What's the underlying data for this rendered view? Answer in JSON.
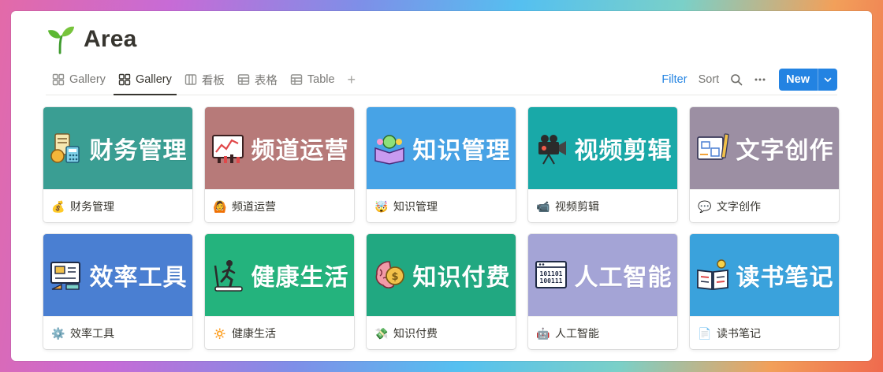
{
  "page": {
    "title": "Area",
    "icon": "seedling-icon"
  },
  "tabs": [
    {
      "label": "Gallery",
      "icon": "gallery-icon",
      "active": false
    },
    {
      "label": "Gallery",
      "icon": "gallery-icon",
      "active": true
    },
    {
      "label": "看板",
      "icon": "board-icon",
      "active": false
    },
    {
      "label": "表格",
      "icon": "table-icon",
      "active": false
    },
    {
      "label": "Table",
      "icon": "table-icon",
      "active": false
    }
  ],
  "add_view": "+",
  "actions": {
    "filter": "Filter",
    "sort": "Sort",
    "new": "New"
  },
  "accent": "#2383e2",
  "cards": [
    {
      "cover_text": "财务管理",
      "title": "财务管理",
      "emoji": "💰",
      "cover_color": "#3a9e93",
      "cover_icon": "money-calculator-icon"
    },
    {
      "cover_text": "频道运营",
      "title": "频道运营",
      "emoji": "🙆",
      "cover_color": "#b77a79",
      "cover_icon": "chart-board-icon"
    },
    {
      "cover_text": "知识管理",
      "title": "知识管理",
      "emoji": "🤯",
      "cover_color": "#47a3e6",
      "cover_icon": "book-idea-icon"
    },
    {
      "cover_text": "视频剪辑",
      "title": "视频剪辑",
      "emoji": "📹",
      "cover_color": "#19a9a8",
      "cover_icon": "video-camera-icon"
    },
    {
      "cover_text": "文字创作",
      "title": "文字创作",
      "emoji": "💬",
      "cover_color": "#9c8fa3",
      "cover_icon": "blueprint-pencil-icon"
    },
    {
      "cover_text": "效率工具",
      "title": "效率工具",
      "emoji": "⚙️",
      "cover_color": "#4a7fd2",
      "cover_icon": "tools-board-icon"
    },
    {
      "cover_text": "健康生活",
      "title": "健康生活",
      "emoji": "🔅",
      "cover_color": "#24b37d",
      "cover_icon": "treadmill-icon"
    },
    {
      "cover_text": "知识付费",
      "title": "知识付费",
      "emoji": "💸",
      "cover_color": "#21a881",
      "cover_icon": "brain-coin-icon"
    },
    {
      "cover_text": "人工智能",
      "title": "人工智能",
      "emoji": "🤖",
      "cover_color": "#a4a4d6",
      "cover_icon": "binary-window-icon"
    },
    {
      "cover_text": "读书笔记",
      "title": "读书笔记",
      "emoji": "📄",
      "cover_color": "#3aa2dc",
      "cover_icon": "open-book-bulb-icon"
    }
  ]
}
